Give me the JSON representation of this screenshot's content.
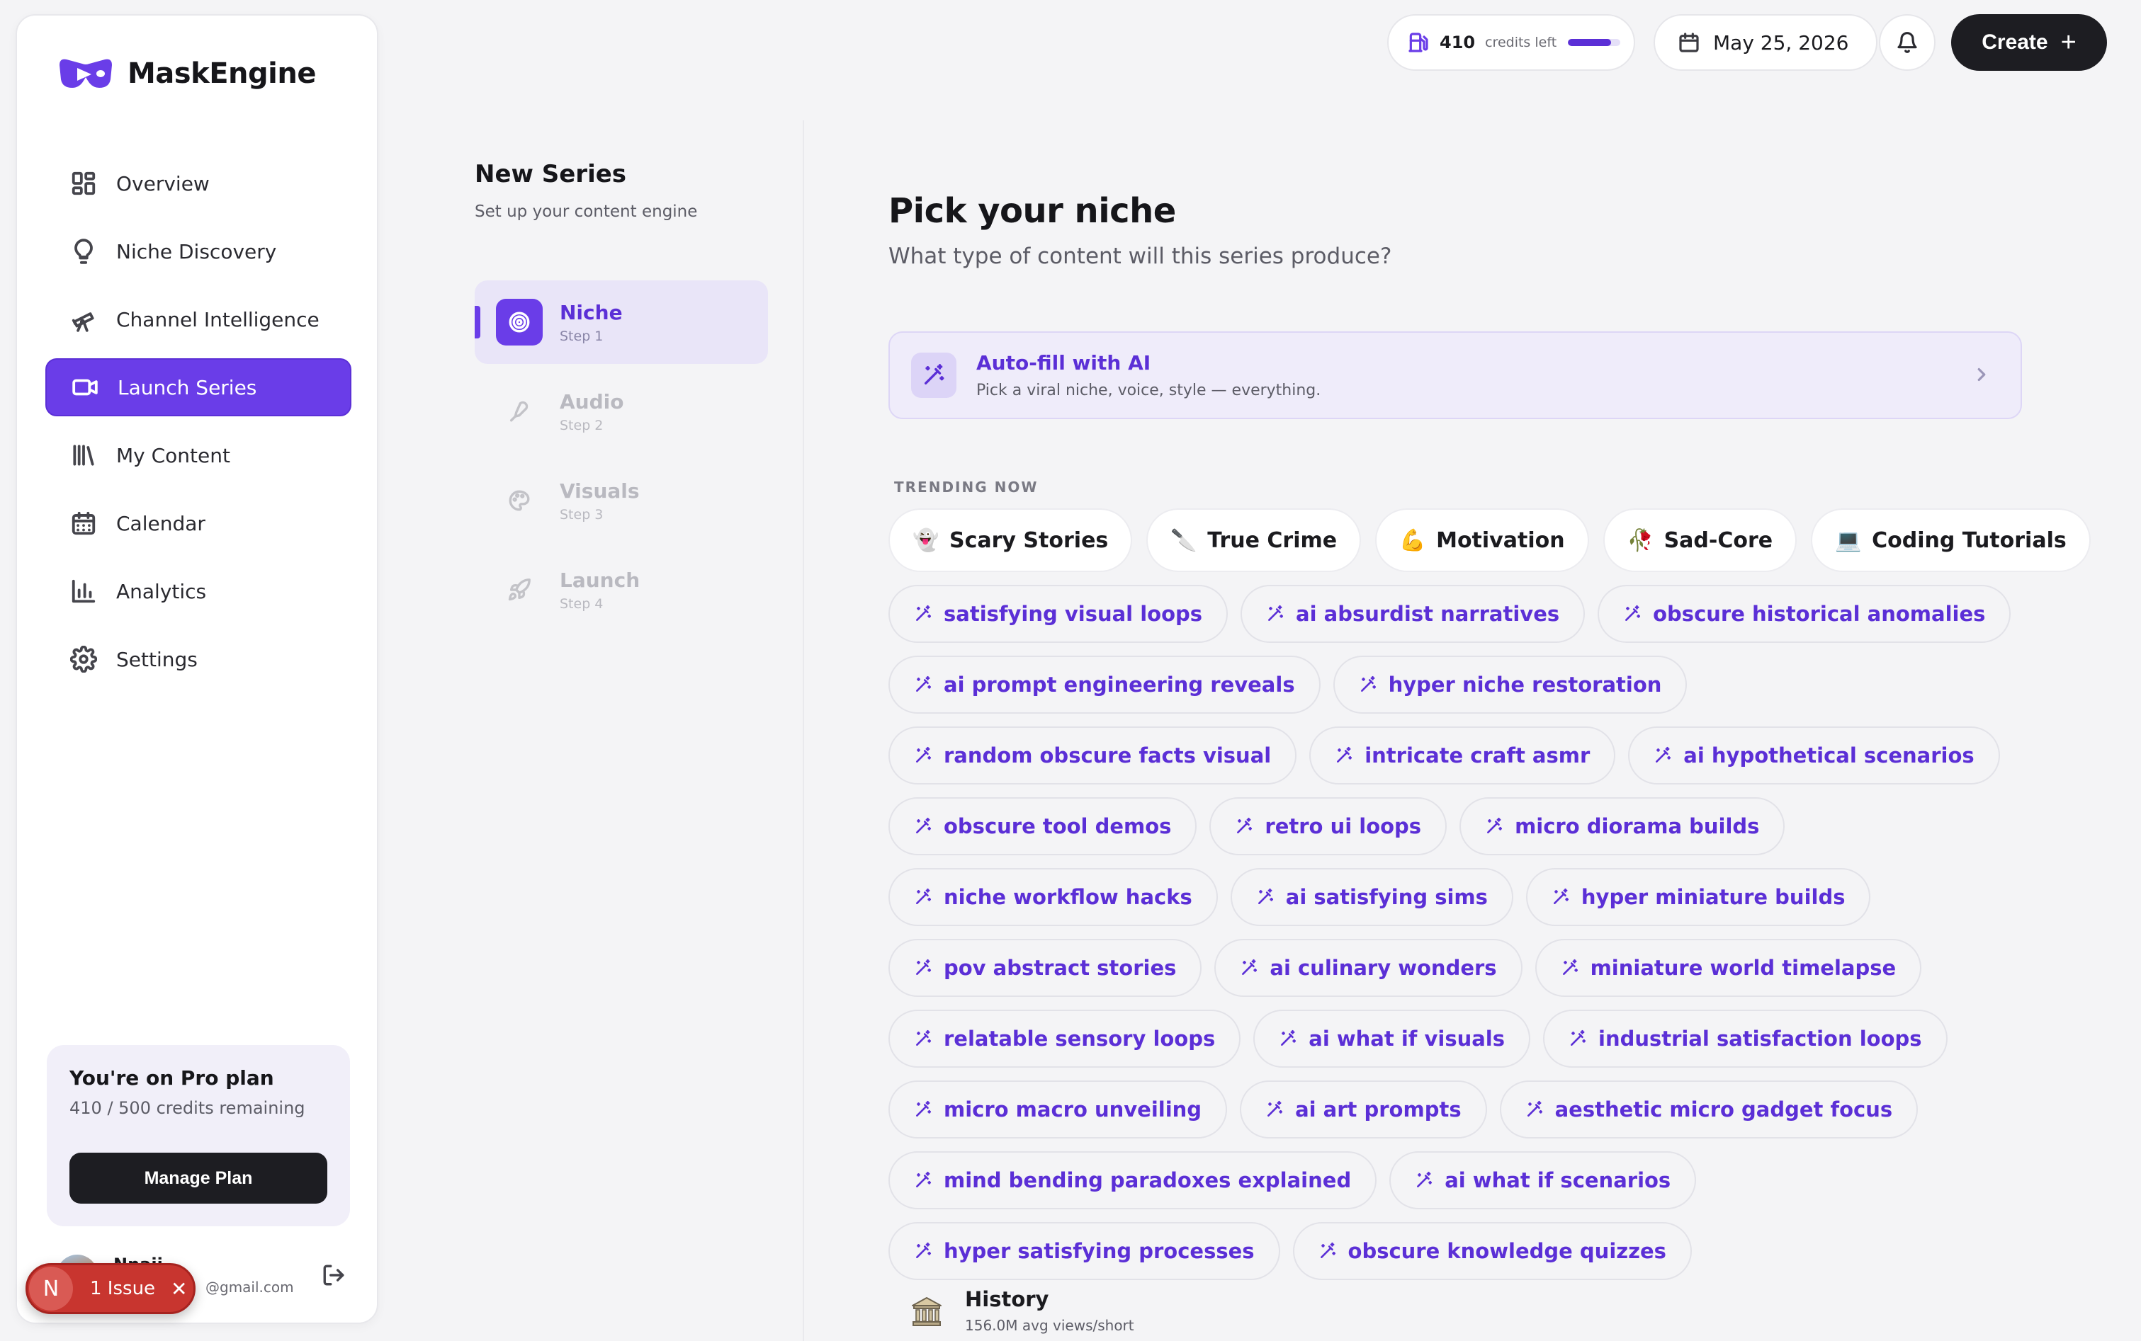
{
  "app": {
    "name": "MaskEngine",
    "brand_color": "#6a3de8"
  },
  "sidebar": {
    "items": [
      {
        "label": "Overview",
        "icon": "grid-icon",
        "active": false
      },
      {
        "label": "Niche Discovery",
        "icon": "lightbulb-icon",
        "active": false
      },
      {
        "label": "Channel Intelligence",
        "icon": "telescope-icon",
        "active": false
      },
      {
        "label": "Launch Series",
        "icon": "video-camera-icon",
        "active": true
      },
      {
        "label": "My Content",
        "icon": "library-icon",
        "active": false
      },
      {
        "label": "Calendar",
        "icon": "calendar-icon",
        "active": false
      },
      {
        "label": "Analytics",
        "icon": "bar-chart-icon",
        "active": false
      },
      {
        "label": "Settings",
        "icon": "gear-icon",
        "active": false
      }
    ],
    "plan": {
      "title": "You're on Pro plan",
      "credits_text": "410 / 500 credits remaining",
      "button": "Manage Plan"
    },
    "user": {
      "name": "Nnaji",
      "email": "@gmail.com"
    }
  },
  "issue_badge": {
    "initial": "N",
    "label": "1 Issue",
    "close": "✕"
  },
  "topbar": {
    "credits_value": "410",
    "credits_label": "credits left",
    "credits_fraction": 0.82,
    "date": "May 25, 2026",
    "create_label": "Create",
    "create_plus": "+"
  },
  "stepper": {
    "title": "New Series",
    "subtitle": "Set up your content engine",
    "steps": [
      {
        "name": "Niche",
        "num": "Step 1",
        "icon": "target-icon",
        "active": true
      },
      {
        "name": "Audio",
        "num": "Step 2",
        "icon": "microphone-icon",
        "active": false
      },
      {
        "name": "Visuals",
        "num": "Step 3",
        "icon": "palette-icon",
        "active": false
      },
      {
        "name": "Launch",
        "num": "Step 4",
        "icon": "rocket-icon",
        "active": false
      }
    ]
  },
  "main": {
    "title": "Pick your niche",
    "subtitle": "What type of content will this series produce?",
    "autofill": {
      "title": "Auto-fill with AI",
      "subtitle": "Pick a viral niche, voice, style — everything."
    },
    "trending_label": "TRENDING NOW",
    "trending": [
      {
        "emoji": "👻",
        "label": "Scary Stories"
      },
      {
        "emoji": "🔪",
        "label": "True Crime"
      },
      {
        "emoji": "💪",
        "label": "Motivation"
      },
      {
        "emoji": "🥀",
        "label": "Sad-Core"
      },
      {
        "emoji": "💻",
        "label": "Coding Tutorials"
      }
    ],
    "suggestions": [
      "satisfying visual loops",
      "ai absurdist narratives",
      "obscure historical anomalies",
      "ai prompt engineering reveals",
      "hyper niche restoration",
      "random obscure facts visual",
      "intricate craft asmr",
      "ai hypothetical scenarios",
      "obscure tool demos",
      "retro ui loops",
      "micro diorama builds",
      "niche workflow hacks",
      "ai satisfying sims",
      "hyper miniature builds",
      "pov abstract stories",
      "ai culinary wonders",
      "miniature world timelapse",
      "relatable sensory loops",
      "ai what if visuals",
      "industrial satisfaction loops",
      "micro macro unveiling",
      "ai art prompts",
      "aesthetic micro gadget focus",
      "mind bending paradoxes explained",
      "ai what if scenarios",
      "hyper satisfying processes",
      "obscure knowledge quizzes"
    ],
    "history": {
      "name": "History",
      "stat": "156.0M avg views/short"
    }
  }
}
